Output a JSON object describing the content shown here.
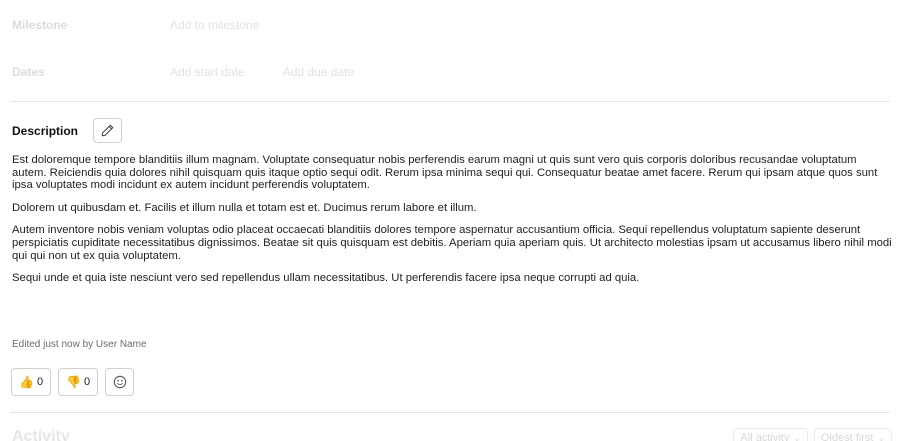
{
  "milestone": {
    "label": "Milestone",
    "value": "Add to milestone"
  },
  "dates": {
    "label": "Dates",
    "start": "Add start date",
    "due": "Add due date"
  },
  "description": {
    "title": "Description",
    "paragraphs": [
      "Est doloremque tempore blanditiis illum magnam. Voluptate consequatur nobis perferendis earum magni ut quis sunt vero quis corporis doloribus recusandae voluptatum autem. Reiciendis quia dolores nihil quisquam quis itaque optio sequi odit. Rerum ipsa minima sequi qui. Consequatur beatae amet facere. Rerum qui ipsam atque quos sunt ipsa voluptates modi incidunt ex autem incidunt perferendis voluptatem.",
      "Dolorem ut quibusdam et. Facilis et illum nulla et totam est et. Ducimus rerum labore et illum.",
      "Autem inventore nobis veniam voluptas odio placeat occaecati blanditiis dolores tempore aspernatur accusantium officia. Sequi repellendus voluptatum sapiente deserunt perspiciatis cupiditate necessitatibus dignissimos. Beatae sit quis quisquam est debitis. Aperiam quia aperiam quis. Ut architecto molestias ipsam ut accusamus libero nihil modi qui qui non ut ex quia voluptatem.",
      "Sequi unde et quia iste nesciunt vero sed repellendus ullam necessitatibus. Ut perferendis facere ipsa neque corrupti ad quia."
    ],
    "edited_note": "Edited just now by User Name"
  },
  "reactions": {
    "thumbs_up": {
      "icon": "thumbs-up-icon",
      "count": "0"
    },
    "thumbs_down": {
      "icon": "thumbs-down-icon",
      "count": "0"
    },
    "add_icon": "smiley-icon"
  },
  "activity": {
    "title": "Activity",
    "filter": "All activity",
    "sort": "Oldest first"
  }
}
